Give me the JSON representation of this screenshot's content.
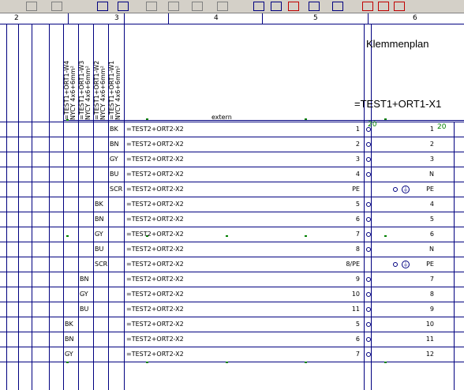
{
  "toolbar": {
    "icons": [
      "grid-icon",
      "grid-icon",
      "table-icon",
      "print-icon",
      "copy-icon",
      "copy-icon",
      "print-icon",
      "paste-icon",
      "zoom-icon",
      "dots-icon",
      "wire-icon",
      "pencil-icon",
      "route-icon",
      "line-icon",
      "symbol-icon",
      "cross-icon"
    ]
  },
  "ruler": {
    "labels": [
      "2",
      "3",
      "4",
      "5",
      "6"
    ]
  },
  "header": {
    "title": "Klemmenplan",
    "subtitle": "=TEST1+ORT1-X1",
    "extern_label": "extern",
    "counter": "20"
  },
  "cables": [
    {
      "id": "=TEST1+ORT1-W4",
      "type": "NYCY",
      "spec": "4x6+6mm²"
    },
    {
      "id": "=TEST1+ORT1-W3",
      "type": "NYCY",
      "spec": "4x6+6mm²"
    },
    {
      "id": "=TEST1+ORT1-W2",
      "type": "NYCY",
      "spec": "4x6+6mm²"
    },
    {
      "id": "=TEST1+ORT1-W1",
      "type": "NYCY",
      "spec": "4x6+6mm²"
    }
  ],
  "rows": [
    {
      "color": "BK",
      "col": 3,
      "target": "=TEST2+ORT2-X2",
      "term": "1",
      "int": "1"
    },
    {
      "color": "BN",
      "col": 3,
      "target": "=TEST2+ORT2-X2",
      "term": "2",
      "int": "2"
    },
    {
      "color": "GY",
      "col": 3,
      "target": "=TEST2+ORT2-X2",
      "term": "3",
      "int": "3"
    },
    {
      "color": "BU",
      "col": 3,
      "target": "=TEST2+ORT2-X2",
      "term": "4",
      "int": "N"
    },
    {
      "color": "SCR",
      "col": 3,
      "target": "=TEST2+ORT2-X2",
      "term": "PE",
      "int": "PE"
    },
    {
      "color": "BK",
      "col": 2,
      "target": "=TEST2+ORT2-X2",
      "term": "5",
      "int": "4"
    },
    {
      "color": "BN",
      "col": 2,
      "target": "=TEST2+ORT2-X2",
      "term": "6",
      "int": "5"
    },
    {
      "color": "GY",
      "col": 2,
      "target": "=TEST2+ORT2-X2",
      "term": "7",
      "int": "6"
    },
    {
      "color": "BU",
      "col": 2,
      "target": "=TEST2+ORT2-X2",
      "term": "8",
      "int": "N"
    },
    {
      "color": "SCR",
      "col": 2,
      "target": "=TEST2+ORT2-X2",
      "term": "8/PE",
      "int": "PE"
    },
    {
      "color": "BN",
      "col": 1,
      "target": "=TEST2+ORT2-X2",
      "term": "9",
      "int": "7"
    },
    {
      "color": "GY",
      "col": 1,
      "target": "=TEST2+ORT2-X2",
      "term": "10",
      "int": "8"
    },
    {
      "color": "BU",
      "col": 1,
      "target": "=TEST2+ORT2-X2",
      "term": "11",
      "int": "9"
    },
    {
      "color": "BK",
      "col": 0,
      "target": "=TEST2+ORT2-X2",
      "term": "5",
      "int": "10"
    },
    {
      "color": "BN",
      "col": 0,
      "target": "=TEST2+ORT2-X2",
      "term": "6",
      "int": "11"
    },
    {
      "color": "GY",
      "col": 0,
      "target": "=TEST2+ORT2-X2",
      "term": "7",
      "int": "12"
    }
  ],
  "colors": {
    "line": "#000080",
    "marker": "#008000",
    "toolbar": "#d4d0c8"
  }
}
